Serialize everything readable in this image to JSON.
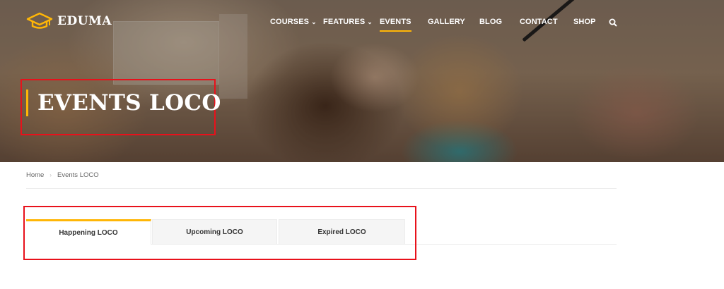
{
  "brand": {
    "name": "EDUMA",
    "accent": "#ffb606"
  },
  "nav": {
    "items": [
      {
        "label": "COURSES",
        "has_dropdown": true
      },
      {
        "label": "FEATURES",
        "has_dropdown": true
      },
      {
        "label": "EVENTS",
        "active": true
      },
      {
        "label": "GALLERY"
      },
      {
        "label": "BLOG"
      },
      {
        "label": "CONTACT"
      },
      {
        "label": "SHOP"
      }
    ],
    "search_icon": "search-icon"
  },
  "hero": {
    "title": "EVENTS LOCO"
  },
  "breadcrumb": {
    "home": "Home",
    "current": "Events LOCO"
  },
  "tabs": [
    {
      "label": "Happening LOCO",
      "active": true
    },
    {
      "label": "Upcoming LOCO"
    },
    {
      "label": "Expired LOCO"
    }
  ],
  "highlight_color": "#e8111b"
}
